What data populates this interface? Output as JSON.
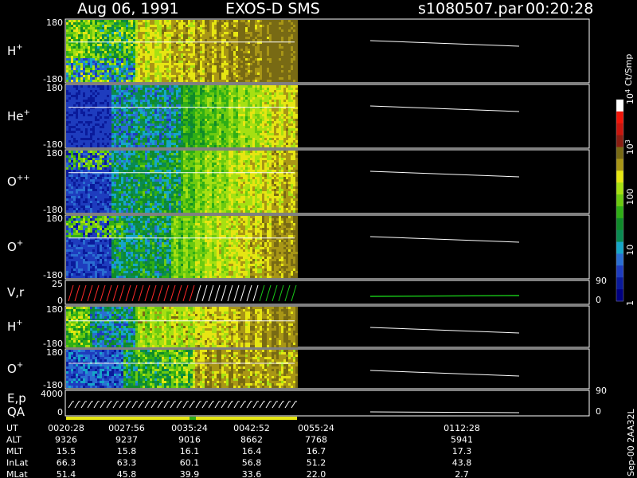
{
  "header": {
    "date": "Aug 06, 1991",
    "instrument": "EXOS-D SMS",
    "file": "s1080507.par",
    "time": "00:20:28"
  },
  "colors": {
    "background": "#000000",
    "palette": [
      "#000080",
      "#0a1a9a",
      "#1e3cbe",
      "#2a6ed2",
      "#16a6c8",
      "#0a8a52",
      "#0f8a2a",
      "#2fae16",
      "#6cca10",
      "#a6e012",
      "#e6e612",
      "#a89616",
      "#786a14",
      "#8a1e12",
      "#c8160e",
      "#f0160a",
      "#ffffff"
    ],
    "trace": "#ffffff",
    "trace_red": "#ff2a2a",
    "trace_green": "#18c818"
  },
  "colorbar": {
    "unit": "Ct/Smp",
    "labels": [
      {
        "text": "1",
        "value": 1
      },
      {
        "text": "10",
        "value": 10
      },
      {
        "text": "100",
        "value": 100
      },
      {
        "text": "10",
        "sup": "3",
        "value": 1000
      },
      {
        "text": "10",
        "sup": "4",
        "value": 10000
      }
    ]
  },
  "panels": [
    {
      "label": "H",
      "sup": "+",
      "top_tick": "180",
      "bottom_tick": "-180",
      "kind": "spectrogram",
      "style": "h"
    },
    {
      "label": "He",
      "sup": "+",
      "top_tick": "180",
      "bottom_tick": "-180",
      "kind": "spectrogram",
      "style": "he"
    },
    {
      "label": "O",
      "sup": "++",
      "top_tick": "180",
      "bottom_tick": "-180",
      "kind": "spectrogram",
      "style": "opp"
    },
    {
      "label": "O",
      "sup": "+",
      "top_tick": "180",
      "bottom_tick": "-180",
      "kind": "spectrogram",
      "style": "op"
    },
    {
      "label": "V,r",
      "sup": "",
      "top_tick": "25",
      "bottom_tick": "0",
      "right_top_tick": "90",
      "right_bottom_tick": "0",
      "kind": "line"
    },
    {
      "label": "H",
      "sup": "+",
      "top_tick": "180",
      "bottom_tick": "-180",
      "kind": "spectrogram",
      "style": "h2"
    },
    {
      "label": "O",
      "sup": "+",
      "top_tick": "180",
      "bottom_tick": "-180",
      "kind": "spectrogram",
      "style": "op2"
    },
    {
      "label": "E,p",
      "label2": "QA",
      "sup": "",
      "top_tick": "4000",
      "bottom_tick": "0",
      "right_top_tick": "90",
      "right_bottom_tick": "0",
      "kind": "ep"
    }
  ],
  "ephemeris": {
    "rows": [
      {
        "name": "UT",
        "values": [
          "0020:28",
          "0027:56",
          "0035:24",
          "0042:52",
          "0055:24",
          "0112:28"
        ]
      },
      {
        "name": "ALT",
        "values": [
          "9326",
          "9237",
          "9016",
          "8662",
          "7768",
          "5941"
        ]
      },
      {
        "name": "MLT",
        "values": [
          "15.5",
          "15.8",
          "16.1",
          "16.4",
          "16.7",
          "17.3"
        ]
      },
      {
        "name": "InLat",
        "values": [
          "66.3",
          "63.3",
          "60.1",
          "56.8",
          "51.2",
          "43.8"
        ]
      },
      {
        "name": "MLat",
        "values": [
          "51.4",
          "45.8",
          "39.9",
          "33.6",
          "22.0",
          "2.7"
        ]
      }
    ],
    "footer": "Sep-00  2AA32L"
  }
}
